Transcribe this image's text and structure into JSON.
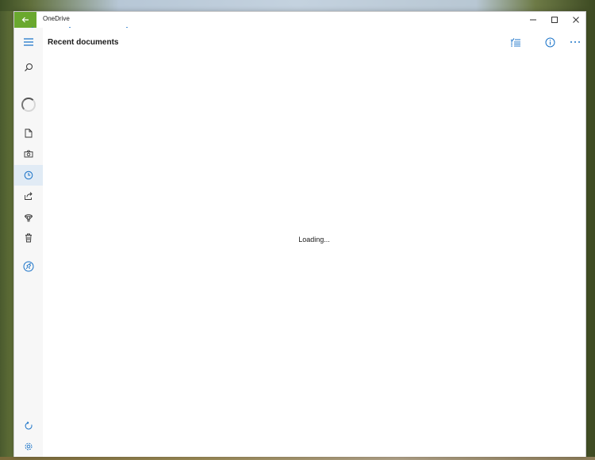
{
  "window": {
    "app_title": "OneDrive"
  },
  "header": {
    "page_title": "Recent documents"
  },
  "main": {
    "loading_text": "Loading..."
  },
  "colors": {
    "accent": "#1a73c8",
    "back_button": "#6aa82e",
    "selected_nav": "#e1ebf5"
  },
  "sidebar": {
    "items": [
      {
        "icon": "hamburger-menu-icon"
      },
      {
        "icon": "search-icon"
      },
      {
        "icon": "spinner-icon"
      },
      {
        "icon": "file-icon"
      },
      {
        "icon": "camera-icon"
      },
      {
        "icon": "clock-icon",
        "selected": true
      },
      {
        "icon": "share-icon"
      },
      {
        "icon": "balloon-icon"
      },
      {
        "icon": "trash-icon"
      },
      {
        "icon": "premium-icon"
      },
      {
        "icon": "sync-icon"
      },
      {
        "icon": "settings-gear-icon"
      }
    ]
  },
  "toolbar": {
    "items": [
      {
        "icon": "select-list-icon"
      },
      {
        "icon": "info-icon"
      },
      {
        "icon": "more-options-icon"
      }
    ]
  }
}
